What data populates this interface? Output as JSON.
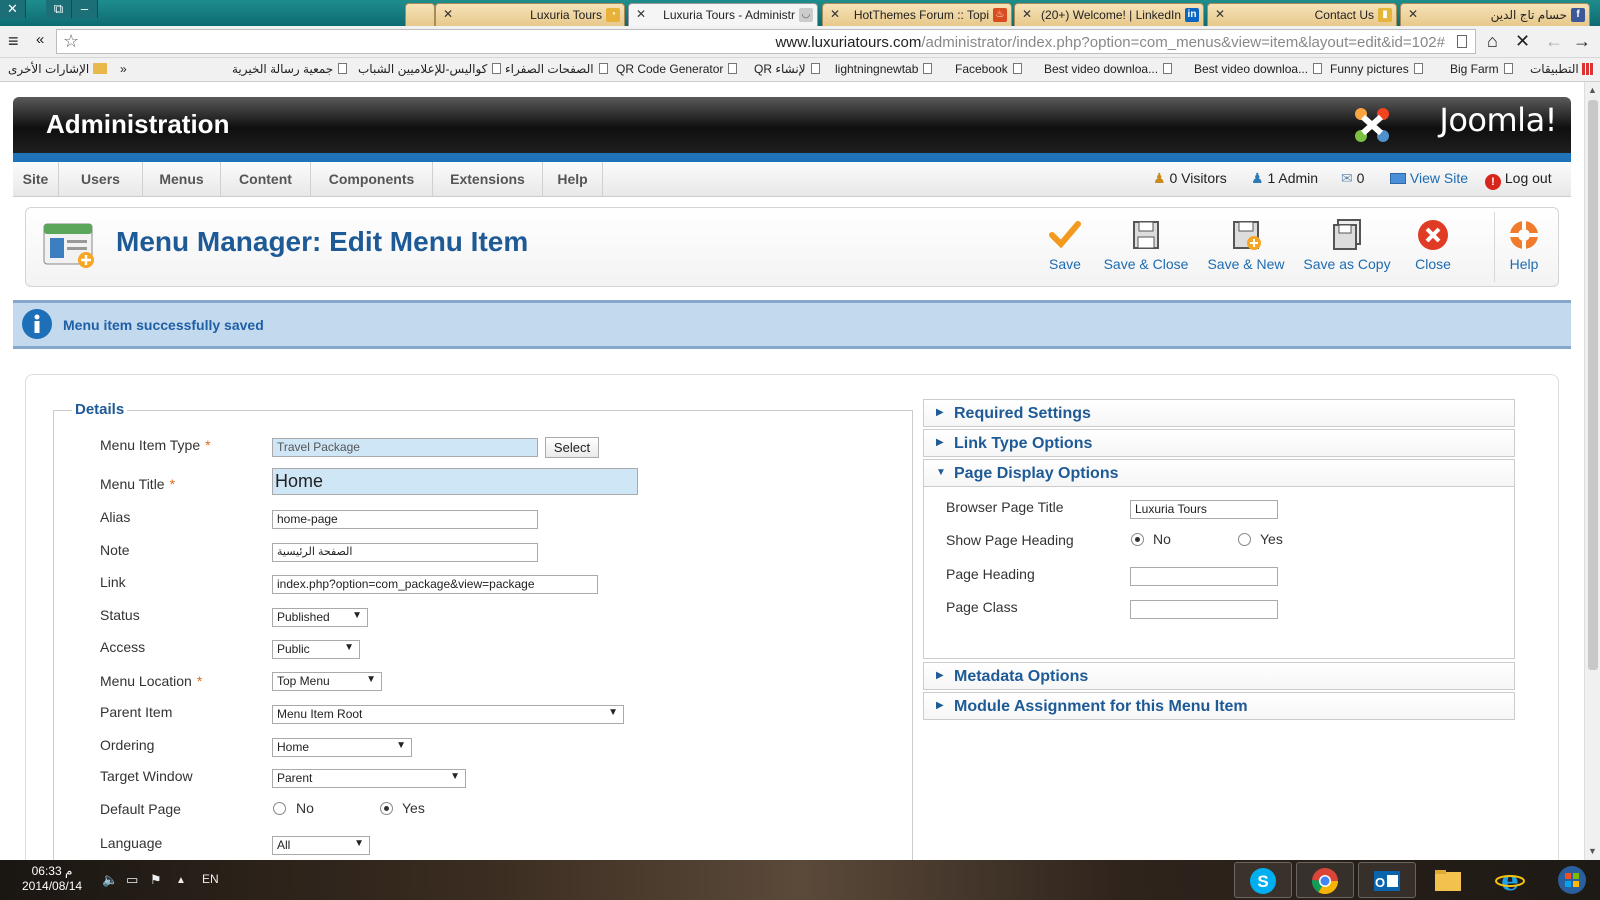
{
  "browser": {
    "tabs": [
      {
        "title": "",
        "active": false
      },
      {
        "title": "Luxuria Tours",
        "active": false
      },
      {
        "title": "Luxuria Tours - Administr",
        "active": true
      },
      {
        "title": "HotThemes Forum :: Topi",
        "active": false
      },
      {
        "title": "(20+) Welcome! | LinkedIn",
        "active": false
      },
      {
        "title": "Contact Us",
        "active": false
      },
      {
        "title": "حسام تاج الدين",
        "active": false
      }
    ],
    "url_host": "www.luxuriatours.com",
    "url_path": "/administrator/index.php?option=com_menus&view=item&layout=edit&id=102#",
    "bookmarks": [
      "الإشارات الأخرى",
      "جمعية رسالة الخيرية",
      "كواليس-للإعلاميين الشباب",
      "الصفحات الصفراء",
      "QR Code Generator",
      "QR لإنشاء",
      "lightningnewtab",
      "Facebook",
      "Best video downloa...",
      "Best video downloa...",
      "Funny pictures",
      "Big Farm",
      "التطبيقات"
    ],
    "bookmarks_more": "»"
  },
  "admin": {
    "title": "Administration",
    "logo_text": "Joomla!",
    "menu": [
      "Site",
      "Users",
      "Menus",
      "Content",
      "Components",
      "Extensions",
      "Help"
    ],
    "status": {
      "visitors": "0 Visitors",
      "admins": "1 Admin",
      "messages": "0",
      "view_site": "View Site",
      "logout": "Log out"
    }
  },
  "toolbar": {
    "page_title": "Menu Manager: Edit Menu Item",
    "save": "Save",
    "save_close": "Save & Close",
    "save_new": "Save & New",
    "save_copy": "Save as Copy",
    "close": "Close",
    "help": "Help"
  },
  "message": "Menu item successfully saved",
  "details": {
    "legend": "Details",
    "req_mark": "*",
    "menu_item_type": {
      "label": "Menu Item Type",
      "value": "Travel Package",
      "button": "Select"
    },
    "menu_title": {
      "label": "Menu Title",
      "value": "Home"
    },
    "alias": {
      "label": "Alias",
      "value": "home-page"
    },
    "note": {
      "label": "Note",
      "value": "الصفحة الرئيسية"
    },
    "link": {
      "label": "Link",
      "value": "index.php?option=com_package&view=package"
    },
    "status": {
      "label": "Status",
      "value": "Published"
    },
    "access": {
      "label": "Access",
      "value": "Public"
    },
    "menu_location": {
      "label": "Menu Location",
      "value": "Top Menu"
    },
    "parent_item": {
      "label": "Parent Item",
      "value": "Menu Item Root"
    },
    "ordering": {
      "label": "Ordering",
      "value": "Home"
    },
    "target_window": {
      "label": "Target Window",
      "value": "Parent"
    },
    "default_page": {
      "label": "Default Page",
      "no": "No",
      "yes": "Yes",
      "selected": "Yes"
    },
    "language": {
      "label": "Language",
      "value": "All"
    }
  },
  "panels": {
    "required_settings": "Required Settings",
    "link_type_options": "Link Type Options",
    "page_display_options": "Page Display Options",
    "metadata_options": "Metadata Options",
    "module_assignment": "Module Assignment for this Menu Item",
    "pdo": {
      "browser_page_title": {
        "label": "Browser Page Title",
        "value": "Luxuria Tours"
      },
      "show_page_heading": {
        "label": "Show Page Heading",
        "no": "No",
        "yes": "Yes",
        "selected": "No"
      },
      "page_heading": {
        "label": "Page Heading",
        "value": ""
      },
      "page_class": {
        "label": "Page Class",
        "value": ""
      }
    }
  },
  "taskbar": {
    "time": "06:33 م",
    "date": "2014/08/14",
    "lang": "EN"
  },
  "colors": {
    "accent_blue": "#1e73b9",
    "title_blue": "#1e5a96",
    "message_bg": "#c3d9ee"
  }
}
